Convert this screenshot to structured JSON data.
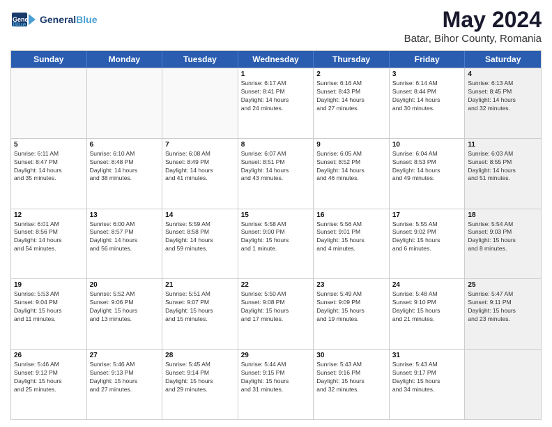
{
  "logo": {
    "line1": "General",
    "line2": "Blue"
  },
  "title": "May 2024",
  "subtitle": "Batar, Bihor County, Romania",
  "days": [
    "Sunday",
    "Monday",
    "Tuesday",
    "Wednesday",
    "Thursday",
    "Friday",
    "Saturday"
  ],
  "rows": [
    [
      {
        "num": "",
        "text": "",
        "empty": true
      },
      {
        "num": "",
        "text": "",
        "empty": true
      },
      {
        "num": "",
        "text": "",
        "empty": true
      },
      {
        "num": "1",
        "text": "Sunrise: 6:17 AM\nSunset: 8:41 PM\nDaylight: 14 hours\nand 24 minutes."
      },
      {
        "num": "2",
        "text": "Sunrise: 6:16 AM\nSunset: 8:43 PM\nDaylight: 14 hours\nand 27 minutes."
      },
      {
        "num": "3",
        "text": "Sunrise: 6:14 AM\nSunset: 8:44 PM\nDaylight: 14 hours\nand 30 minutes."
      },
      {
        "num": "4",
        "text": "Sunrise: 6:13 AM\nSunset: 8:45 PM\nDaylight: 14 hours\nand 32 minutes.",
        "shaded": true
      }
    ],
    [
      {
        "num": "5",
        "text": "Sunrise: 6:11 AM\nSunset: 8:47 PM\nDaylight: 14 hours\nand 35 minutes."
      },
      {
        "num": "6",
        "text": "Sunrise: 6:10 AM\nSunset: 8:48 PM\nDaylight: 14 hours\nand 38 minutes."
      },
      {
        "num": "7",
        "text": "Sunrise: 6:08 AM\nSunset: 8:49 PM\nDaylight: 14 hours\nand 41 minutes."
      },
      {
        "num": "8",
        "text": "Sunrise: 6:07 AM\nSunset: 8:51 PM\nDaylight: 14 hours\nand 43 minutes."
      },
      {
        "num": "9",
        "text": "Sunrise: 6:05 AM\nSunset: 8:52 PM\nDaylight: 14 hours\nand 46 minutes."
      },
      {
        "num": "10",
        "text": "Sunrise: 6:04 AM\nSunset: 8:53 PM\nDaylight: 14 hours\nand 49 minutes."
      },
      {
        "num": "11",
        "text": "Sunrise: 6:03 AM\nSunset: 8:55 PM\nDaylight: 14 hours\nand 51 minutes.",
        "shaded": true
      }
    ],
    [
      {
        "num": "12",
        "text": "Sunrise: 6:01 AM\nSunset: 8:56 PM\nDaylight: 14 hours\nand 54 minutes."
      },
      {
        "num": "13",
        "text": "Sunrise: 6:00 AM\nSunset: 8:57 PM\nDaylight: 14 hours\nand 56 minutes."
      },
      {
        "num": "14",
        "text": "Sunrise: 5:59 AM\nSunset: 8:58 PM\nDaylight: 14 hours\nand 59 minutes."
      },
      {
        "num": "15",
        "text": "Sunrise: 5:58 AM\nSunset: 9:00 PM\nDaylight: 15 hours\nand 1 minute."
      },
      {
        "num": "16",
        "text": "Sunrise: 5:56 AM\nSunset: 9:01 PM\nDaylight: 15 hours\nand 4 minutes."
      },
      {
        "num": "17",
        "text": "Sunrise: 5:55 AM\nSunset: 9:02 PM\nDaylight: 15 hours\nand 6 minutes."
      },
      {
        "num": "18",
        "text": "Sunrise: 5:54 AM\nSunset: 9:03 PM\nDaylight: 15 hours\nand 8 minutes.",
        "shaded": true
      }
    ],
    [
      {
        "num": "19",
        "text": "Sunrise: 5:53 AM\nSunset: 9:04 PM\nDaylight: 15 hours\nand 11 minutes."
      },
      {
        "num": "20",
        "text": "Sunrise: 5:52 AM\nSunset: 9:06 PM\nDaylight: 15 hours\nand 13 minutes."
      },
      {
        "num": "21",
        "text": "Sunrise: 5:51 AM\nSunset: 9:07 PM\nDaylight: 15 hours\nand 15 minutes."
      },
      {
        "num": "22",
        "text": "Sunrise: 5:50 AM\nSunset: 9:08 PM\nDaylight: 15 hours\nand 17 minutes."
      },
      {
        "num": "23",
        "text": "Sunrise: 5:49 AM\nSunset: 9:09 PM\nDaylight: 15 hours\nand 19 minutes."
      },
      {
        "num": "24",
        "text": "Sunrise: 5:48 AM\nSunset: 9:10 PM\nDaylight: 15 hours\nand 21 minutes."
      },
      {
        "num": "25",
        "text": "Sunrise: 5:47 AM\nSunset: 9:11 PM\nDaylight: 15 hours\nand 23 minutes.",
        "shaded": true
      }
    ],
    [
      {
        "num": "26",
        "text": "Sunrise: 5:46 AM\nSunset: 9:12 PM\nDaylight: 15 hours\nand 25 minutes."
      },
      {
        "num": "27",
        "text": "Sunrise: 5:46 AM\nSunset: 9:13 PM\nDaylight: 15 hours\nand 27 minutes."
      },
      {
        "num": "28",
        "text": "Sunrise: 5:45 AM\nSunset: 9:14 PM\nDaylight: 15 hours\nand 29 minutes."
      },
      {
        "num": "29",
        "text": "Sunrise: 5:44 AM\nSunset: 9:15 PM\nDaylight: 15 hours\nand 31 minutes."
      },
      {
        "num": "30",
        "text": "Sunrise: 5:43 AM\nSunset: 9:16 PM\nDaylight: 15 hours\nand 32 minutes."
      },
      {
        "num": "31",
        "text": "Sunrise: 5:43 AM\nSunset: 9:17 PM\nDaylight: 15 hours\nand 34 minutes."
      },
      {
        "num": "",
        "text": "",
        "empty": true,
        "shaded": true
      }
    ]
  ]
}
